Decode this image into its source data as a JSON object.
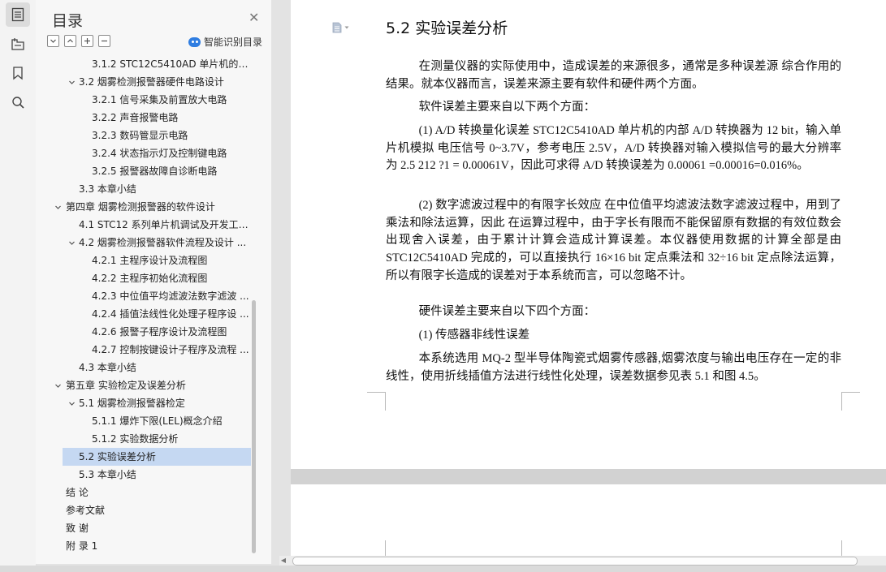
{
  "toc": {
    "title": "目录",
    "smart_label": "智能识别目录",
    "items": [
      {
        "label": "3.1.2 STC12C5410AD 单片机的 ..."
      },
      {
        "label": "3.2 烟雾检测报警器硬件电路设计"
      },
      {
        "label": "3.2.1 信号采集及前置放大电路"
      },
      {
        "label": "3.2.2 声音报警电路"
      },
      {
        "label": "3.2.3 数码管显示电路"
      },
      {
        "label": "3.2.4 状态指示灯及控制键电路"
      },
      {
        "label": "3.2.5 报警器故障自诊断电路"
      },
      {
        "label": "3.3 本章小结"
      },
      {
        "label": "第四章  烟雾检测报警器的软件设计"
      },
      {
        "label": "4.1 STC12 系列单片机调试及开发工 ..."
      },
      {
        "label": "4.2 烟雾检测报警器软件流程及设计 ..."
      },
      {
        "label": "4.2.1 主程序设计及流程图"
      },
      {
        "label": "4.2.2 主程序初始化流程图"
      },
      {
        "label": "4.2.3 中位值平均滤波法数字滤波 ..."
      },
      {
        "label": "4.2.4 插值法线性化处理子程序设 ..."
      },
      {
        "label": "4.2.6 报警子程序设计及流程图"
      },
      {
        "label": "4.2.7 控制按键设计子程序及流程 ..."
      },
      {
        "label": "4.3 本章小结"
      },
      {
        "label": "第五章  实验检定及误差分析"
      },
      {
        "label": "5.1 烟雾检测报警器检定"
      },
      {
        "label": "5.1.1 爆炸下限(LEL)概念介绍"
      },
      {
        "label": "5.1.2 实验数据分析"
      },
      {
        "label": "5.2 实验误差分析"
      },
      {
        "label": "5.3 本章小结"
      },
      {
        "label": "结  论"
      },
      {
        "label": "参考文献"
      },
      {
        "label": "致  谢"
      },
      {
        "label": "附    录 1"
      }
    ]
  },
  "document": {
    "heading": "5.2 实验误差分析",
    "paragraphs": [
      "在测量仪器的实际使用中，造成误差的来源很多，通常是多种误差源  综合作用的结果。就本仪器而言，误差来源主要有软件和硬件两个方面。",
      "软件误差主要来自以下两个方面：",
      "(1)      A/D 转换量化误差 STC12C5410AD 单片机的内部 A/D 转换器为 12 bit，输入单片机模拟  电压信号 0~3.7V，参考电压 2.5V，A/D 转换器对输入模拟信号的最大分辨率为 2.5 212 ?1 = 0.00061V，因此可求得 A/D 转换误差为 0.00061 =0.00016=0.016%。",
      "(2)      数字滤波过程中的有限字长效应  在中位值平均滤波法数字滤波过程中，用到了乘法和除法运算，因此  在运算过程中，由于字长有限而不能保留原有数据的有效位数会出现舍入误差，由于累计计算会造成计算误差。本仪器使用数据的计算全部是由 STC12C5410AD 完成的，可以直接执行 16×16 bit 定点乘法和 32÷16 bit 定点除法运算，所以有限字长造成的误差对于本系统而言，可以忽略不计。",
      "硬件误差主要来自以下四个方面：",
      "(1)      传感器非线性误差",
      "本系统选用 MQ-2 型半导体陶瓷式烟雾传感器,烟雾浓度与输出电压存在一定的非线性，使用折线插值方法进行线性化处理，误差数据参见表 5.1 和图 4.5。"
    ]
  },
  "colors": {
    "selected_item": "#c5d8f2",
    "accent": "#2f7de1"
  }
}
